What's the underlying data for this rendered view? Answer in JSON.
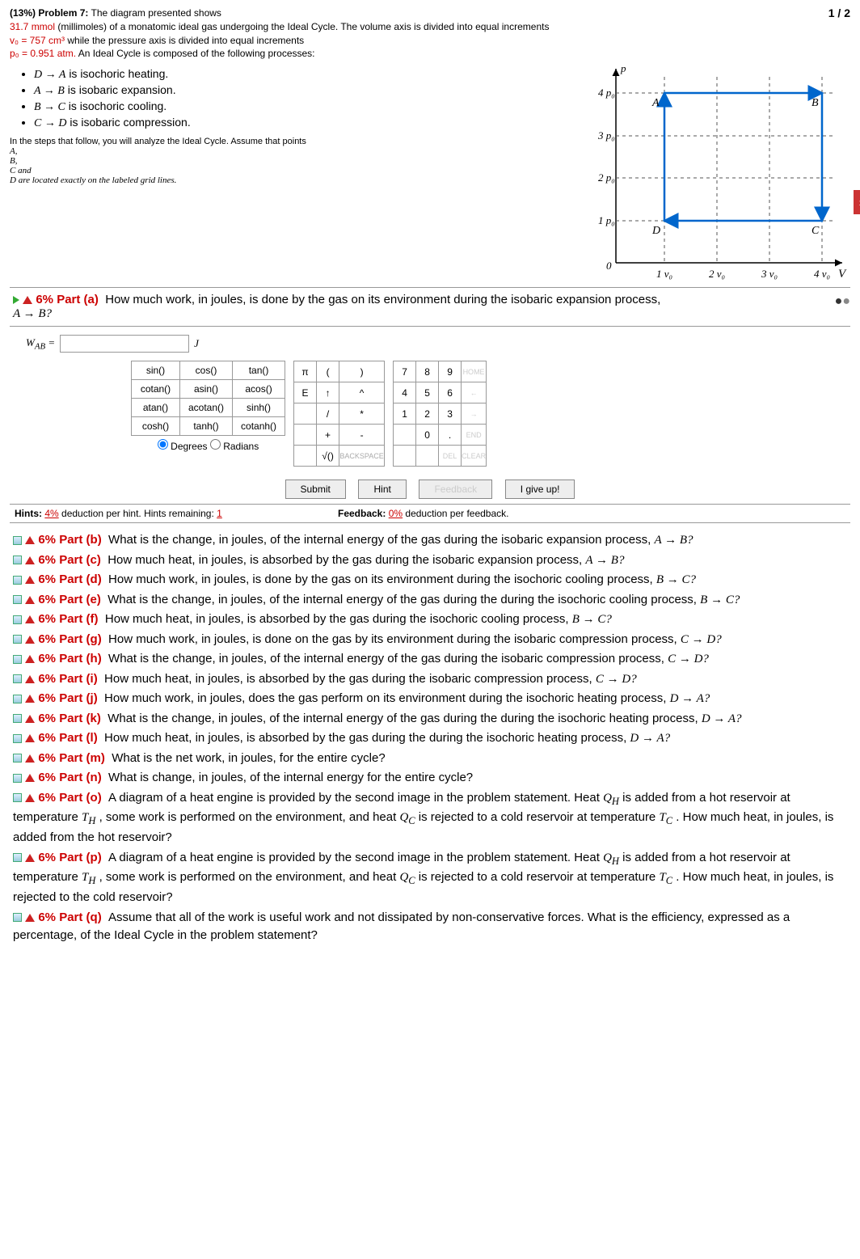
{
  "header": {
    "pct": "(13%)",
    "label": "Problem 7:",
    "line1": "The diagram presented shows",
    "line2a": "31.7 mmol",
    "line2b": "(millimoles) of a monatomic ideal gas undergoing the Ideal Cycle. The volume axis is divided into equal increments",
    "v0": "v₀ = 757 cm³",
    "line3b": "while the pressure axis is divided into equal increments",
    "p0": "p₀ = 0.951 atm.",
    "line4b": "An Ideal Cycle is composed of the following processes:",
    "page": "1 / 2"
  },
  "processes": [
    {
      "arrow": "D → A",
      "desc": "is isochoric heating."
    },
    {
      "arrow": "A → B",
      "desc": "is isobaric expansion."
    },
    {
      "arrow": "B → C",
      "desc": "is isochoric cooling."
    },
    {
      "arrow": "C → D",
      "desc": "is isobaric compression."
    }
  ],
  "note": {
    "l1": "In the steps that follow, you will analyze the Ideal Cycle. Assume that points",
    "pA": "A,",
    "pB": "B,",
    "pC": "C and",
    "l2": "D are located exactly on the labeled grid lines."
  },
  "chart_data": {
    "type": "line",
    "xlabel": "V",
    "ylabel": "p",
    "xticks": [
      "1 v₀",
      "2 v₀",
      "3 v₀",
      "4 v₀"
    ],
    "yticks": [
      "1 p₀",
      "2 p₀",
      "3 p₀",
      "4 p₀"
    ],
    "points": {
      "A": {
        "x": 1,
        "y": 4
      },
      "B": {
        "x": 4,
        "y": 4
      },
      "C": {
        "x": 4,
        "y": 1
      },
      "D": {
        "x": 1,
        "y": 1
      }
    },
    "cycle": [
      "A",
      "B",
      "C",
      "D",
      "A"
    ]
  },
  "part_a": {
    "pct": "6%",
    "label": "Part (a)",
    "q": "How much work, in joules, is done by the gas on its environment during the isobaric expansion process,",
    "eq": "A → B?",
    "var": "W",
    "sub": "AB",
    "unit": "J"
  },
  "keypad": {
    "funcs": [
      [
        "sin()",
        "cos()",
        "tan()"
      ],
      [
        "cotan()",
        "asin()",
        "acos()"
      ],
      [
        "atan()",
        "acotan()",
        "sinh()"
      ],
      [
        "cosh()",
        "tanh()",
        "cotanh()"
      ]
    ],
    "deg": "Degrees",
    "rad": "Radians",
    "syms": [
      [
        "π",
        "(",
        ")"
      ],
      [
        "E",
        "↑",
        "^"
      ],
      [
        "",
        "/",
        "*"
      ],
      [
        "",
        "+",
        "-"
      ],
      [
        "",
        "√()",
        "BACKSPACE"
      ]
    ],
    "nums": [
      [
        "7",
        "8",
        "9",
        "HOME"
      ],
      [
        "4",
        "5",
        "6",
        "←"
      ],
      [
        "1",
        "2",
        "3",
        "→"
      ],
      [
        "",
        "0",
        ".",
        "END"
      ],
      [
        "",
        "",
        "DEL",
        "CLEAR"
      ]
    ]
  },
  "actions": {
    "submit": "Submit",
    "hint": "Hint",
    "feedback": "Feedback",
    "giveup": "I give up!"
  },
  "hints": {
    "left_a": "Hints:",
    "left_pct": "4%",
    "left_b": "deduction per hint. Hints remaining:",
    "left_n": "1",
    "right_a": "Feedback:",
    "right_pct": "0%",
    "right_b": "deduction per feedback."
  },
  "parts": [
    {
      "pct": "6%",
      "label": "Part (b)",
      "q": "What is the change, in joules, of the internal energy of the gas during the isobaric expansion process,",
      "eq": "A → B?"
    },
    {
      "pct": "6%",
      "label": "Part (c)",
      "q": "How much heat, in joules, is absorbed by the gas during the isobaric expansion process,",
      "eq": "A → B?"
    },
    {
      "pct": "6%",
      "label": "Part (d)",
      "q": "How much work, in joules, is done by the gas on its environment during the isochoric cooling process,",
      "eq": "B → C?"
    },
    {
      "pct": "6%",
      "label": "Part (e)",
      "q": "What is the change, in joules, of the internal energy of the gas during the during the isochoric cooling process,",
      "eq": "B → C?"
    },
    {
      "pct": "6%",
      "label": "Part (f)",
      "q": "How much heat, in joules, is absorbed by the gas during the isochoric cooling process,",
      "eq": "B → C?"
    },
    {
      "pct": "6%",
      "label": "Part (g)",
      "q": "How much work, in joules, is done on the gas by its environment during the isobaric compression process,",
      "eq": "C → D?"
    },
    {
      "pct": "6%",
      "label": "Part (h)",
      "q": "What is the change, in joules, of the internal energy of the gas during the isobaric compression process,",
      "eq": "C → D?"
    },
    {
      "pct": "6%",
      "label": "Part (i)",
      "q": "How much heat, in joules, is absorbed by the gas during the isobaric compression process,",
      "eq": "C → D?"
    },
    {
      "pct": "6%",
      "label": "Part (j)",
      "q": "How much work, in joules, does the gas perform on its environment during the isochoric heating process,",
      "eq": "D → A?"
    },
    {
      "pct": "6%",
      "label": "Part (k)",
      "q": "What is the change, in joules, of the internal energy of the gas during the during the isochoric heating process,",
      "eq": "D → A?"
    },
    {
      "pct": "6%",
      "label": "Part (l)",
      "q": "How much heat, in joules, is absorbed by the gas during the during the isochoric heating process,",
      "eq": "D → A?"
    },
    {
      "pct": "6%",
      "label": "Part (m)",
      "q": "What is the net work, in joules, for the entire cycle?",
      "eq": ""
    },
    {
      "pct": "6%",
      "label": "Part (n)",
      "q": "What is change, in joules, of the internal energy for the entire cycle?",
      "eq": ""
    },
    {
      "pct": "6%",
      "label": "Part (o)",
      "q": "A diagram of a heat engine is provided by the second image in the problem statement. Heat Q_H is added from a hot reservoir at temperature T_H , some work is performed on the environment, and heat Q_C is rejected to a cold reservoir at temperature T_C . How much heat, in joules, is added from the hot reservoir?",
      "eq": ""
    },
    {
      "pct": "6%",
      "label": "Part (p)",
      "q": "A diagram of a heat engine is provided by the second image in the problem statement. Heat Q_H is added from a hot reservoir at temperature T_H , some work is performed on the environment, and heat Q_C is rejected to a cold reservoir at temperature T_C . How much heat, in joules, is rejected to the cold reservoir?",
      "eq": ""
    },
    {
      "pct": "6%",
      "label": "Part (q)",
      "q": "Assume that all of the work is useful work and not dissipated by non-conservative forces. What is the efficiency, expressed as a percentage, of the Ideal Cycle in the problem statement?",
      "eq": ""
    }
  ]
}
